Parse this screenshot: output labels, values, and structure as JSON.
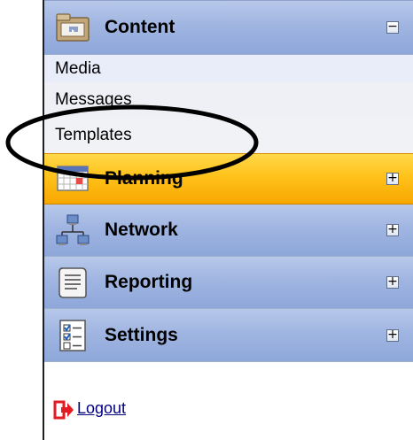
{
  "sidebar": {
    "sections": [
      {
        "label": "Content",
        "toggle": "−",
        "expanded": true,
        "icon": "folder-icon"
      },
      {
        "label": "Planning",
        "toggle": "+",
        "expanded": false,
        "icon": "calendar-grid-icon"
      },
      {
        "label": "Network",
        "toggle": "+",
        "expanded": false,
        "icon": "network-icon"
      },
      {
        "label": "Reporting",
        "toggle": "+",
        "expanded": false,
        "icon": "scroll-report-icon"
      },
      {
        "label": "Settings",
        "toggle": "+",
        "expanded": false,
        "icon": "checklist-icon"
      }
    ],
    "content_items": [
      {
        "label": "Media"
      },
      {
        "label": "Messages"
      },
      {
        "label": "Templates"
      }
    ]
  },
  "logout": {
    "label": "Logout",
    "icon": "logout-arrow-icon"
  },
  "colors": {
    "section_blue": "#a0b5e1",
    "section_active": "#ffc21a",
    "link": "#000080",
    "logout_icon": "#e31b23"
  }
}
